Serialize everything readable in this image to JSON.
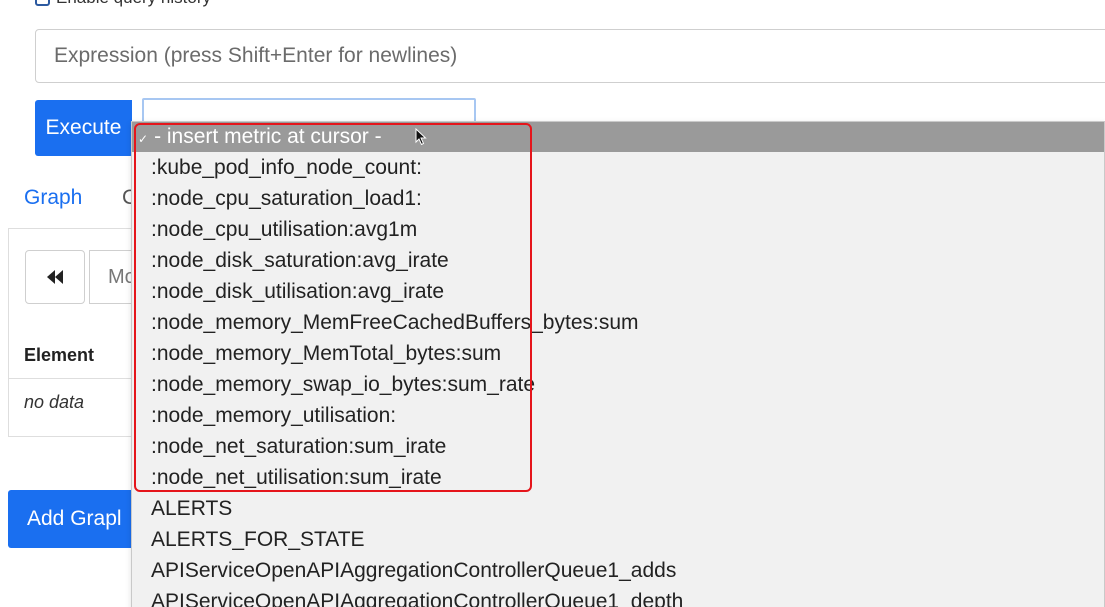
{
  "history": {
    "label": "Enable query history"
  },
  "expression": {
    "placeholder": "Expression (press Shift+Enter for newlines)"
  },
  "toolbar": {
    "execute_label": "Execute"
  },
  "tabs": {
    "graph_label": "Graph",
    "console_fragment": "C"
  },
  "console": {
    "rewind_icon": "double-chevron-left-icon",
    "moment_fragment": "Mo",
    "element_header": "Element",
    "no_data": "no data"
  },
  "add_graph": {
    "label_fragment": "Add Grapl"
  },
  "dropdown": {
    "selected_label": "- insert metric at cursor -",
    "items": [
      ":kube_pod_info_node_count:",
      ":node_cpu_saturation_load1:",
      ":node_cpu_utilisation:avg1m",
      ":node_disk_saturation:avg_irate",
      ":node_disk_utilisation:avg_irate",
      ":node_memory_MemFreeCachedBuffers_bytes:sum",
      ":node_memory_MemTotal_bytes:sum",
      ":node_memory_swap_io_bytes:sum_rate",
      ":node_memory_utilisation:",
      ":node_net_saturation:sum_irate",
      ":node_net_utilisation:sum_irate",
      "ALERTS",
      "ALERTS_FOR_STATE",
      "APIServiceOpenAPIAggregationControllerQueue1_adds",
      "APIServiceOpenAPIAggregationControllerQueue1_depth"
    ]
  },
  "colors": {
    "primary": "#1a6ff0",
    "selected_row": "#9a9a9a",
    "highlight": "#e5151b"
  }
}
